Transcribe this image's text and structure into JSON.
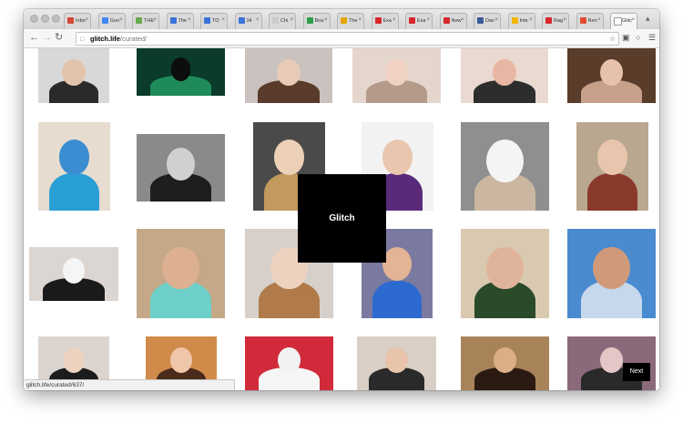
{
  "browser": {
    "tabs": [
      {
        "label": "Inbo",
        "favicon_color": "#d44638"
      },
      {
        "label": "Goo",
        "favicon_color": "#4285f4"
      },
      {
        "label": "THE",
        "favicon_color": "#6aa84f"
      },
      {
        "label": "The",
        "favicon_color": "#3b73d9"
      },
      {
        "label": "TO",
        "favicon_color": "#3b73d9"
      },
      {
        "label": "04",
        "favicon_color": "#3b73d9"
      },
      {
        "label": "Chi",
        "favicon_color": "#cccccc"
      },
      {
        "label": "Boa",
        "favicon_color": "#2e9e4a"
      },
      {
        "label": "The",
        "favicon_color": "#e8a400"
      },
      {
        "label": "Exa",
        "favicon_color": "#d6282b"
      },
      {
        "label": "Exa",
        "favicon_color": "#d6282b"
      },
      {
        "label": "New",
        "favicon_color": "#d6282b"
      },
      {
        "label": "Dan",
        "favicon_color": "#3b5998"
      },
      {
        "label": "Inte",
        "favicon_color": "#f4b400"
      },
      {
        "label": "Rag",
        "favicon_color": "#d6282b"
      },
      {
        "label": "Ren",
        "favicon_color": "#e34b2f"
      },
      {
        "label": "Glitc",
        "favicon_color": "#ffffff"
      }
    ],
    "url_host": "glitch.life",
    "url_path": "/curated/",
    "status_text": "glitch.life/curated/637/"
  },
  "page": {
    "overlay_title": "Glitch",
    "next_label": "Next"
  },
  "colors": {
    "overlay_bg": "#000000",
    "page_bg": "#ffffff"
  }
}
